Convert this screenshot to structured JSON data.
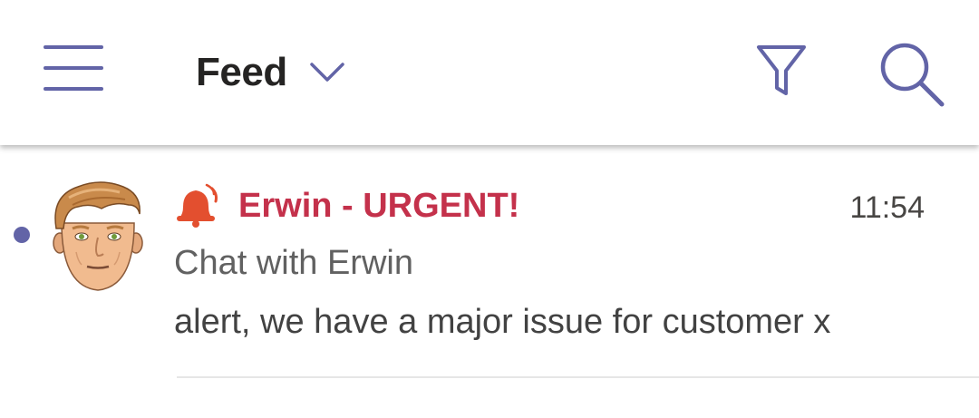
{
  "header": {
    "title": "Feed",
    "icons": {
      "menu": "hamburger-menu-icon",
      "dropdown": "chevron-down-icon",
      "filter": "filter-icon",
      "search": "search-icon"
    }
  },
  "feed": {
    "items": [
      {
        "sender": "Erwin - URGENT!",
        "time": "11:54",
        "title": "Chat with Erwin",
        "preview": "alert, we have a major issue for customer x",
        "unread": true,
        "icon": "urgent-bell-icon"
      }
    ]
  },
  "colors": {
    "accent": "#6264a7",
    "urgent": "#c4314b",
    "bell": "#e34f2f",
    "text_primary": "#252423",
    "text_secondary": "#616161"
  }
}
